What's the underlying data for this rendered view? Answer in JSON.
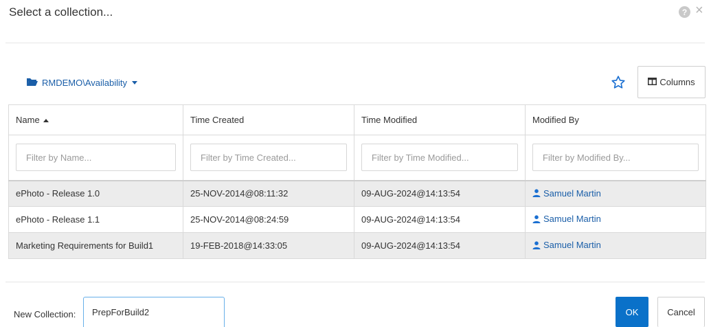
{
  "dialog": {
    "title": "Select a collection...",
    "help_icon": "question-circle-icon",
    "close_label": "×"
  },
  "toolbar": {
    "folder_icon": "folder-open-icon",
    "path_label": "RMDEMO\\Availability",
    "favorite_icon": "star-outline-icon",
    "columns_icon": "columns-icon",
    "columns_label": "Columns"
  },
  "table": {
    "columns": [
      {
        "label": "Name",
        "sort": "ascending",
        "filter_placeholder": "Filter by Name..."
      },
      {
        "label": "Time Created",
        "filter_placeholder": "Filter by Time Created..."
      },
      {
        "label": "Time Modified",
        "filter_placeholder": "Filter by Time Modified..."
      },
      {
        "label": "Modified By",
        "filter_placeholder": "Filter by Modified By..."
      }
    ],
    "rows": [
      {
        "name": "ePhoto - Release 1.0",
        "created": "25-NOV-2014@08:11:32",
        "modified": "09-AUG-2024@14:13:54",
        "modified_by": "Samuel Martin",
        "selected": true
      },
      {
        "name": "ePhoto - Release 1.1",
        "created": "25-NOV-2014@08:24:59",
        "modified": "09-AUG-2024@14:13:54",
        "modified_by": "Samuel Martin",
        "selected": false
      },
      {
        "name": "Marketing Requirements for Build1",
        "created": "19-FEB-2018@14:33:05",
        "modified": "09-AUG-2024@14:13:54",
        "modified_by": "Samuel Martin",
        "selected": true
      }
    ]
  },
  "footer": {
    "new_collection_label": "New Collection:",
    "new_collection_value": "PrepForBuild2",
    "ok_label": "OK",
    "cancel_label": "Cancel"
  },
  "colors": {
    "primary": "#0a71c9",
    "link": "#1a5ea8",
    "row_selected": "#ececec"
  }
}
